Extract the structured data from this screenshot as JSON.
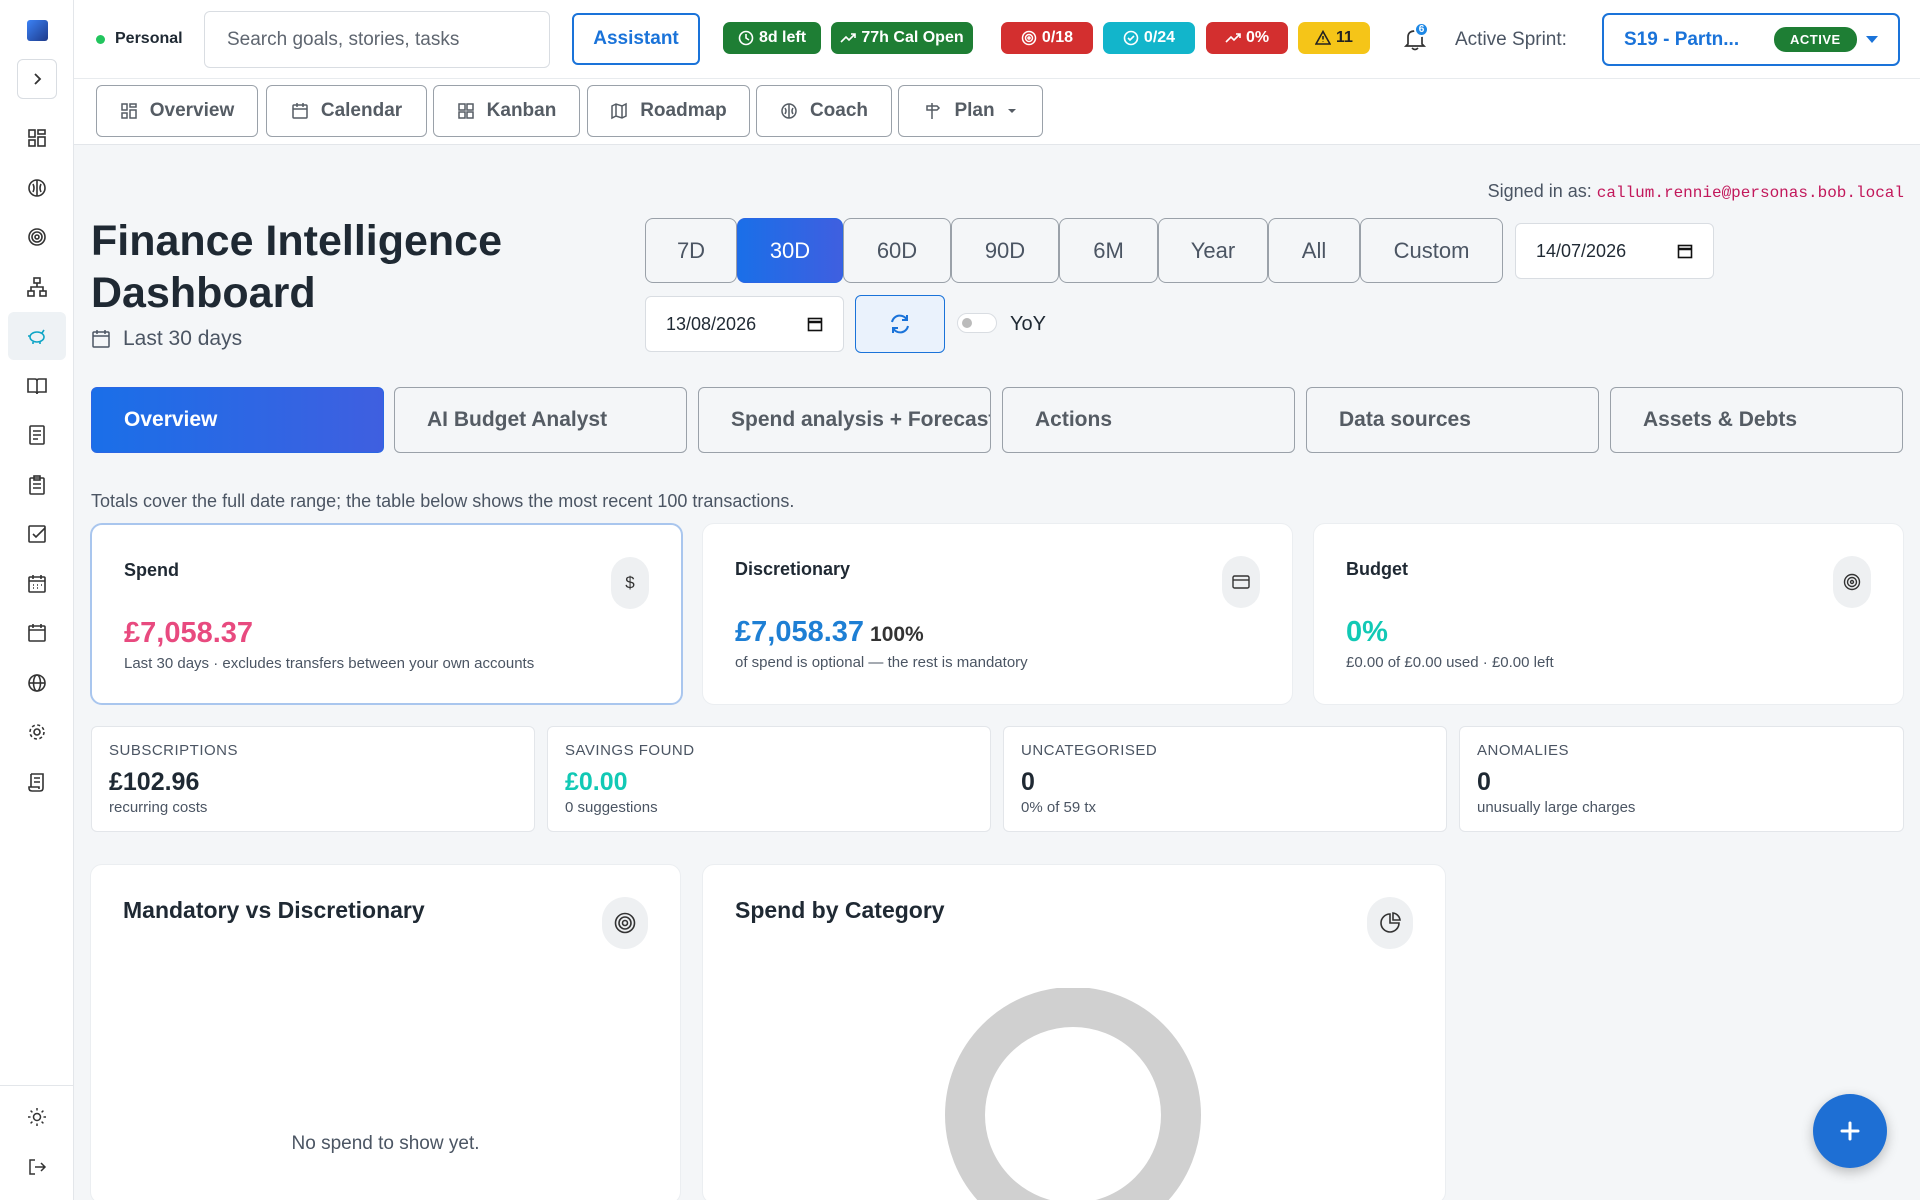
{
  "header": {
    "workspace": "Personal",
    "search_placeholder": "Search goals, stories, tasks",
    "assistant_label": "Assistant",
    "pills": [
      {
        "label": "8d left",
        "icon": "clock-icon",
        "color": "#1e7e34"
      },
      {
        "label": "77h Cal Open",
        "icon": "trend-up-icon",
        "color": "#1e7e34"
      },
      {
        "label": "0/18",
        "icon": "target-icon",
        "color": "#d32f2f"
      },
      {
        "label": "0/24",
        "icon": "check-circle-icon",
        "color": "#12b5cb"
      },
      {
        "label": "0%",
        "icon": "trend-up-icon",
        "color": "#d32f2f"
      },
      {
        "label": "11",
        "icon": "warning-icon",
        "color": "#f5c518"
      }
    ],
    "notification_count": "6",
    "sprint_label": "Active Sprint:",
    "sprint_name": "S19 - Partn...",
    "sprint_status": "ACTIVE"
  },
  "view_tabs": [
    {
      "label": "Overview",
      "icon": "grid-icon"
    },
    {
      "label": "Calendar",
      "icon": "calendar-icon"
    },
    {
      "label": "Kanban",
      "icon": "kanban-icon"
    },
    {
      "label": "Roadmap",
      "icon": "map-icon"
    },
    {
      "label": "Coach",
      "icon": "brain-icon"
    },
    {
      "label": "Plan",
      "icon": "signpost-icon"
    }
  ],
  "signed_in": {
    "prefix": "Signed in as:",
    "email": "callum.rennie@personas.bob.local"
  },
  "page": {
    "title": "Finance Intelligence Dashboard",
    "subtitle": "Last 30 days"
  },
  "ranges": [
    "7D",
    "30D",
    "60D",
    "90D",
    "6M",
    "Year",
    "All",
    "Custom"
  ],
  "active_range": "30D",
  "date_from": "14/07/2026",
  "date_to": "13/08/2026",
  "yoy_label": "YoY",
  "finance_tabs": [
    "Overview",
    "AI Budget Analyst",
    "Spend analysis + Forecast",
    "Actions",
    "Data sources",
    "Assets & Debts"
  ],
  "note": "Totals cover the full date range; the table below shows the most recent 100 transactions.",
  "cards": [
    {
      "label": "Spend",
      "value": "£7,058.37",
      "extra": "",
      "sub": "Last 30 days · excludes transfers between your own accounts",
      "color": "#e84a7f",
      "icon": "dollar-icon"
    },
    {
      "label": "Discretionary",
      "value": "£7,058.37",
      "extra": "100%",
      "sub": "of spend is optional — the rest is mandatory",
      "color": "#1e7fd4",
      "icon": "card-icon"
    },
    {
      "label": "Budget",
      "value": "0%",
      "extra": "",
      "sub": "£0.00 of £0.00 used · £0.00 left",
      "color": "#12c9b5",
      "icon": "target-icon"
    }
  ],
  "stats": [
    {
      "label": "SUBSCRIPTIONS",
      "value": "£102.96",
      "sub": "recurring costs",
      "color": "#1f2933"
    },
    {
      "label": "SAVINGS FOUND",
      "value": "£0.00",
      "sub": "0 suggestions",
      "color": "#12c9b5"
    },
    {
      "label": "UNCATEGORISED",
      "value": "0",
      "sub": "0% of 59 tx",
      "color": "#1f2933"
    },
    {
      "label": "ANOMALIES",
      "value": "0",
      "sub": "unusually large charges",
      "color": "#1f2933"
    }
  ],
  "panels": [
    {
      "title": "Mandatory vs Discretionary",
      "empty": "No spend to show yet."
    },
    {
      "title": "Spend by Category"
    }
  ]
}
